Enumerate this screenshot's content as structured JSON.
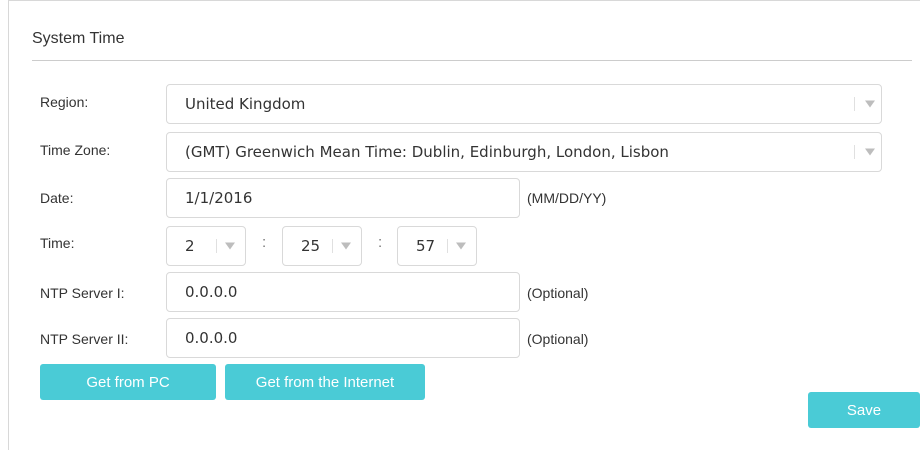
{
  "section": {
    "title": "System Time"
  },
  "region": {
    "label": "Region:",
    "value": "United Kingdom"
  },
  "timezone": {
    "label": "Time Zone:",
    "value": "(GMT) Greenwich Mean Time: Dublin, Edinburgh, London, Lisbon"
  },
  "date": {
    "label": "Date:",
    "value": "1/1/2016",
    "hint": "(MM/DD/YY)"
  },
  "time": {
    "label": "Time:",
    "hour": "2",
    "minute": "25",
    "second": "57",
    "separator": ":"
  },
  "ntp1": {
    "label": "NTP Server I:",
    "value": "0.0.0.0",
    "hint": "(Optional)"
  },
  "ntp2": {
    "label": "NTP Server II:",
    "value": "0.0.0.0",
    "hint": "(Optional)"
  },
  "buttons": {
    "get_from_pc": "Get from PC",
    "get_from_internet": "Get from the Internet",
    "save": "Save"
  },
  "colors": {
    "accent": "#4acbd6",
    "border": "#d9d9d9"
  },
  "icons": {
    "dropdown": "chevron-down-icon"
  }
}
